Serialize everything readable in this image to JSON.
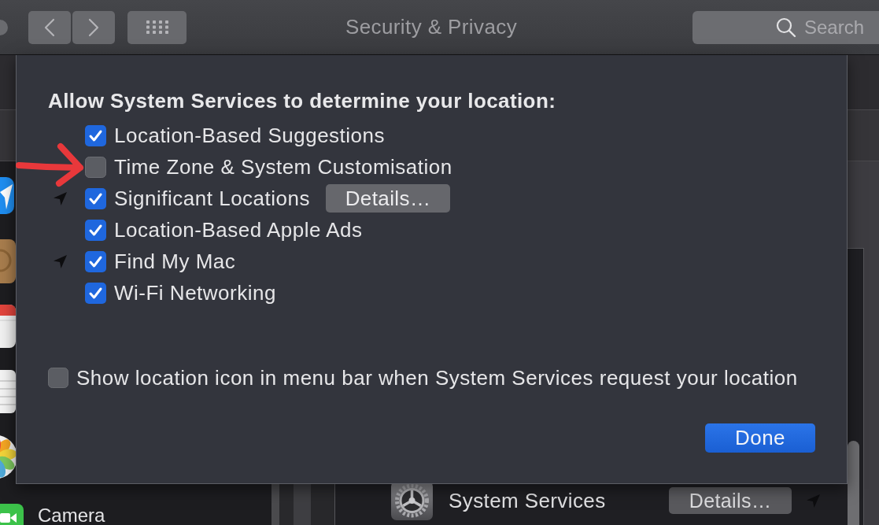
{
  "toolbar": {
    "title": "Security & Privacy",
    "search": {
      "placeholder": "Search"
    }
  },
  "sidebar": {
    "items": [
      {
        "kind": "location"
      },
      {
        "kind": "contacts"
      },
      {
        "kind": "calendar"
      },
      {
        "kind": "reminders"
      },
      {
        "kind": "photos"
      },
      {
        "kind": "camera",
        "label": "Camera"
      }
    ]
  },
  "services_list": {
    "rows": [
      {
        "label": "System Services",
        "button": "Details…",
        "location_used": true
      }
    ]
  },
  "sheet": {
    "heading": "Allow System Services to determine your location:",
    "services": [
      {
        "label": "Location-Based Suggestions",
        "checked": true,
        "location_used": false
      },
      {
        "label": "Time Zone & System Customisation",
        "checked": false,
        "location_used": false
      },
      {
        "label": "Significant Locations",
        "checked": true,
        "location_used": true,
        "button": "Details…"
      },
      {
        "label": "Location-Based Apple Ads",
        "checked": true,
        "location_used": false
      },
      {
        "label": "Find My Mac",
        "checked": true,
        "location_used": true
      },
      {
        "label": "Wi-Fi Networking",
        "checked": true,
        "location_used": false
      }
    ],
    "menu_bar_option": {
      "label": "Show location icon in menu bar when System Services request your location",
      "checked": false
    },
    "done_button": "Done"
  }
}
